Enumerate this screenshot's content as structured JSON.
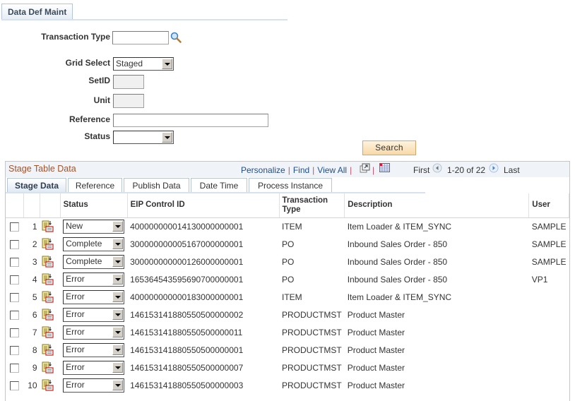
{
  "page_tab": {
    "label": "Data Def Maint"
  },
  "form": {
    "transaction_type": {
      "label": "Transaction Type",
      "value": ""
    },
    "grid_select": {
      "label": "Grid Select",
      "value": "Staged"
    },
    "setid": {
      "label": "SetID",
      "value": ""
    },
    "unit": {
      "label": "Unit",
      "value": ""
    },
    "reference": {
      "label": "Reference",
      "value": ""
    },
    "status": {
      "label": "Status",
      "value": ""
    },
    "search_label": "Search"
  },
  "grid": {
    "title": "Stage Table Data",
    "nav": {
      "personalize": "Personalize",
      "find": "Find",
      "view_all": "View All",
      "sep": "|"
    },
    "pager": {
      "first": "First",
      "range": "1-20 of 22",
      "last": "Last"
    },
    "tabs": [
      {
        "label": "Stage Data",
        "active": true
      },
      {
        "label": "Reference"
      },
      {
        "label": "Publish Data"
      },
      {
        "label": "Date Time"
      },
      {
        "label": "Process Instance"
      }
    ],
    "columns": {
      "status": "Status",
      "eip": "EIP Control ID",
      "trans_type": "Transaction Type",
      "description": "Description",
      "user": "User"
    },
    "rows": [
      {
        "num": "1",
        "status": "New",
        "eip": "400000000014130000000001",
        "type": "ITEM",
        "desc": "Item Loader & ITEM_SYNC",
        "user": "SAMPLE"
      },
      {
        "num": "2",
        "status": "Complete",
        "eip": "300000000005167000000001",
        "type": "PO",
        "desc": "Inbound Sales Order - 850",
        "user": "SAMPLE"
      },
      {
        "num": "3",
        "status": "Complete",
        "eip": "300000000000126000000001",
        "type": "PO",
        "desc": "Inbound Sales Order - 850",
        "user": "SAMPLE"
      },
      {
        "num": "4",
        "status": "Error",
        "eip": "165364543595690700000001",
        "type": "PO",
        "desc": "Inbound Sales Order - 850",
        "user": "VP1"
      },
      {
        "num": "5",
        "status": "Error",
        "eip": "400000000000183000000001",
        "type": "ITEM",
        "desc": "Item Loader & ITEM_SYNC",
        "user": ""
      },
      {
        "num": "6",
        "status": "Error",
        "eip": "146153141880550500000002",
        "type": "PRODUCTMST",
        "desc": "Product Master",
        "user": ""
      },
      {
        "num": "7",
        "status": "Error",
        "eip": "146153141880550500000011",
        "type": "PRODUCTMST",
        "desc": "Product Master",
        "user": ""
      },
      {
        "num": "8",
        "status": "Error",
        "eip": "146153141880550500000001",
        "type": "PRODUCTMST",
        "desc": "Product Master",
        "user": ""
      },
      {
        "num": "9",
        "status": "Error",
        "eip": "146153141880550500000007",
        "type": "PRODUCTMST",
        "desc": "Product Master",
        "user": ""
      },
      {
        "num": "10",
        "status": "Error",
        "eip": "146153141880550500000003",
        "type": "PRODUCTMST",
        "desc": "Product Master",
        "user": ""
      }
    ]
  },
  "icons": {
    "lookup": "magnifier-icon",
    "new_window": "new-window-icon",
    "download": "spreadsheet-icon",
    "prev": "arrow-left-icon",
    "next": "arrow-right-icon",
    "row_detail": "document-detail-icon"
  }
}
